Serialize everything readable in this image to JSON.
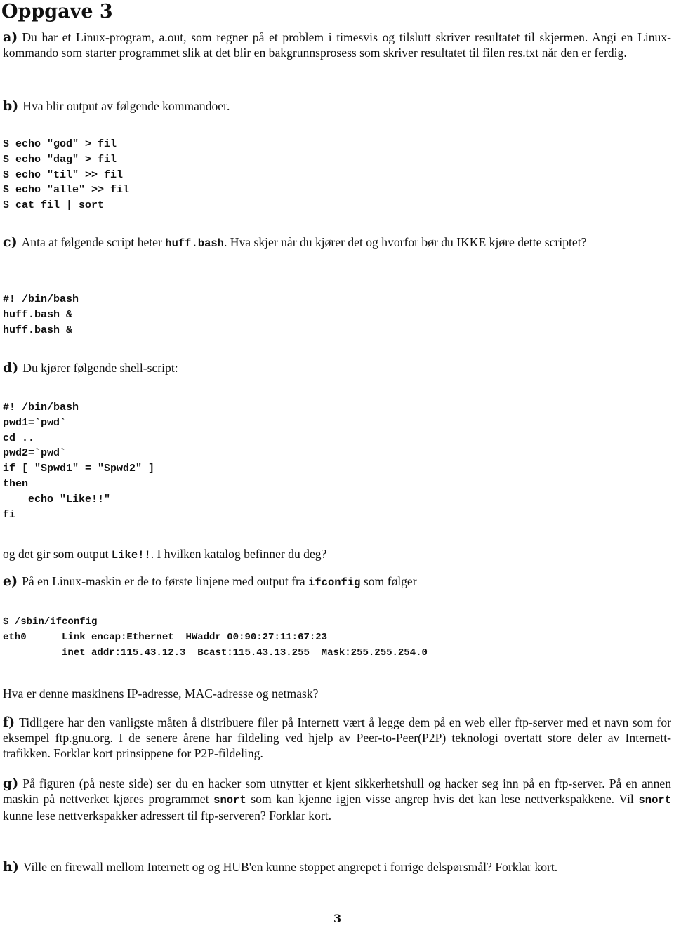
{
  "title": "Oppgave 3",
  "questions": {
    "a": {
      "label": "a)",
      "text": "Du har et Linux-program, a.out, som regner på et problem i timesvis og tilslutt skriver resultatet til skjermen. Angi en Linux-kommando som starter programmet slik at det blir en bakgrunnsprosess som skriver resultatet til filen res.txt når den er ferdig."
    },
    "b": {
      "label": "b)",
      "text": "Hva blir output av følgende kommandoer.",
      "code": [
        "$ echo \"god\" > fil",
        "$ echo \"dag\" > fil",
        "$ echo \"til\" >> fil",
        "$ echo \"alle\" >> fil",
        "$ cat fil | sort"
      ]
    },
    "c": {
      "label": "c)",
      "text_before": "Anta at følgende script heter ",
      "code_inline": "huff.bash",
      "text_after": ". Hva skjer når du kjører det og hvorfor bør du IKKE kjøre dette scriptet?",
      "code": [
        "#! /bin/bash",
        "huff.bash &",
        "huff.bash &"
      ]
    },
    "d": {
      "label": "d)",
      "text": "Du kjører følgende shell-script:",
      "code": [
        "#! /bin/bash",
        "pwd1=`pwd`",
        "cd ..",
        "pwd2=`pwd`",
        "if [ \"$pwd1\" = \"$pwd2\" ]",
        "then",
        "    echo \"Like!!\"",
        "fi"
      ],
      "followup_before": "og det gir som output ",
      "followup_code": "Like!!",
      "followup_after": ". I hvilken katalog befinner du deg?"
    },
    "e": {
      "label": "e)",
      "text_before": "På en Linux-maskin er de to første linjene med output fra ",
      "code_inline": "ifconfig",
      "text_after": " som følger",
      "code": [
        "$ /sbin/ifconfig",
        "eth0      Link encap:Ethernet  HWaddr 00:90:27:11:67:23",
        "          inet addr:115.43.12.3  Bcast:115.43.13.255  Mask:255.255.254.0"
      ],
      "followup": "Hva er denne maskinens IP-adresse, MAC-adresse og netmask?"
    },
    "f": {
      "label": "f)",
      "text": "Tidligere har den vanligste måten å distribuere filer på Internett vært å legge dem på en web eller ftp-server med et navn som for eksempel ftp.gnu.org. I de senere årene har fildeling ved hjelp av Peer-to-Peer(P2P) teknologi overtatt store deler av Internett-trafikken. Forklar kort prinsippene for P2P-fildeling."
    },
    "g": {
      "label": "g)",
      "text_1": "På figuren (på neste side) ser du en hacker som utnytter et kjent sikkerhetshull og hacker seg inn på en ftp-server. På en annen maskin på nettverket kjøres programmet ",
      "code_1": "snort",
      "text_2": " som kan kjenne igjen visse angrep hvis det kan lese nettverkspakkene. Vil ",
      "code_2": "snort",
      "text_3": " kunne lese nettverkspakker adressert til ftp-serveren? Forklar kort."
    },
    "h": {
      "label": "h)",
      "text": "Ville en firewall mellom Internett og og HUB'en kunne stoppet angrepet i forrige delspørsmål? Forklar kort."
    }
  },
  "page_number": "3"
}
